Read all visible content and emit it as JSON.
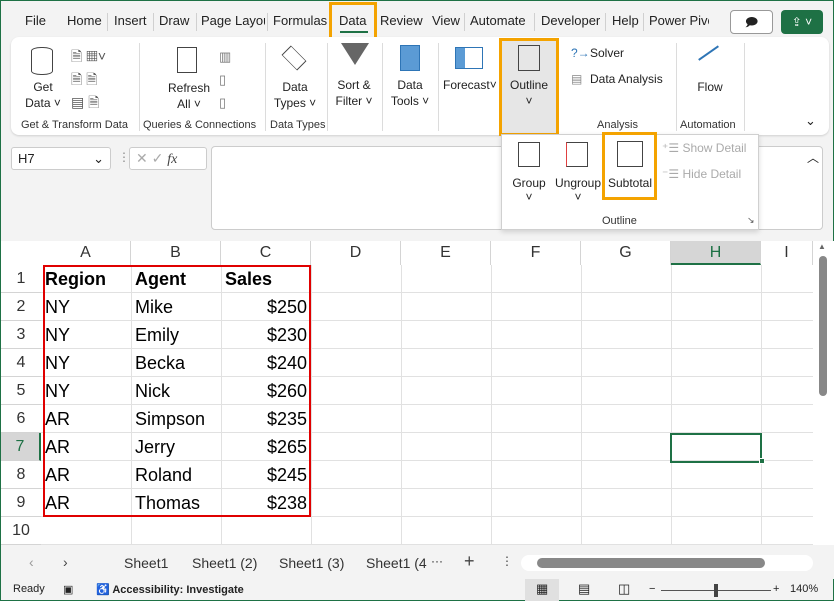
{
  "tabs": [
    "File",
    "Home",
    "Insert",
    "Draw",
    "Page Layou",
    "Formulas",
    "Data",
    "Review",
    "View",
    "Automate",
    "Developer",
    "Help",
    "Power Pivo"
  ],
  "active_tab": "Data",
  "ribbon": {
    "get_data": "Get Data ˅",
    "refresh_all": "Refresh All ˅",
    "data_types": "Data Types ˅",
    "sort_filter": "Sort & Filter ˅",
    "data_tools": "Data Tools ˅",
    "forecast": "Forecast",
    "outline": "Outline",
    "solver": "Solver",
    "data_analysis": "Data Analysis",
    "flow": "Flow",
    "groups": [
      "Get & Transform Data",
      "Queries & Connections",
      "Data Types",
      "Analysis",
      "Automation"
    ]
  },
  "outline_panel": {
    "group": "Group",
    "ungroup": "Ungroup",
    "subtotal": "Subtotal",
    "show_detail": "Show Detail",
    "hide_detail": "Hide Detail",
    "title": "Outline"
  },
  "name_box": "H7",
  "fx": "fx",
  "columns": [
    "A",
    "B",
    "C",
    "D",
    "E",
    "F",
    "G",
    "H",
    "I"
  ],
  "rows": [
    "1",
    "2",
    "3",
    "4",
    "5",
    "6",
    "7",
    "8",
    "9",
    "10"
  ],
  "table": {
    "headers": [
      "Region",
      "Agent",
      "Sales"
    ],
    "rows": [
      [
        "NY",
        "Mike",
        "$250"
      ],
      [
        "NY",
        "Emily",
        "$230"
      ],
      [
        "NY",
        "Becka",
        "$240"
      ],
      [
        "NY",
        "Nick",
        "$260"
      ],
      [
        "AR",
        "Simpson",
        "$235"
      ],
      [
        "AR",
        "Jerry",
        "$265"
      ],
      [
        "AR",
        "Roland",
        "$245"
      ],
      [
        "AR",
        "Thomas",
        "$238"
      ]
    ]
  },
  "sheets": [
    "Sheet1",
    "Sheet1 (2)",
    "Sheet1 (3)",
    "Sheet1 (4"
  ],
  "status": {
    "ready": "Ready",
    "accessibility": "Accessibility: Investigate",
    "zoom": "140%"
  },
  "colors": {
    "accent": "#1e7145",
    "highlight": "#f4a300",
    "table_border": "#e00000"
  }
}
